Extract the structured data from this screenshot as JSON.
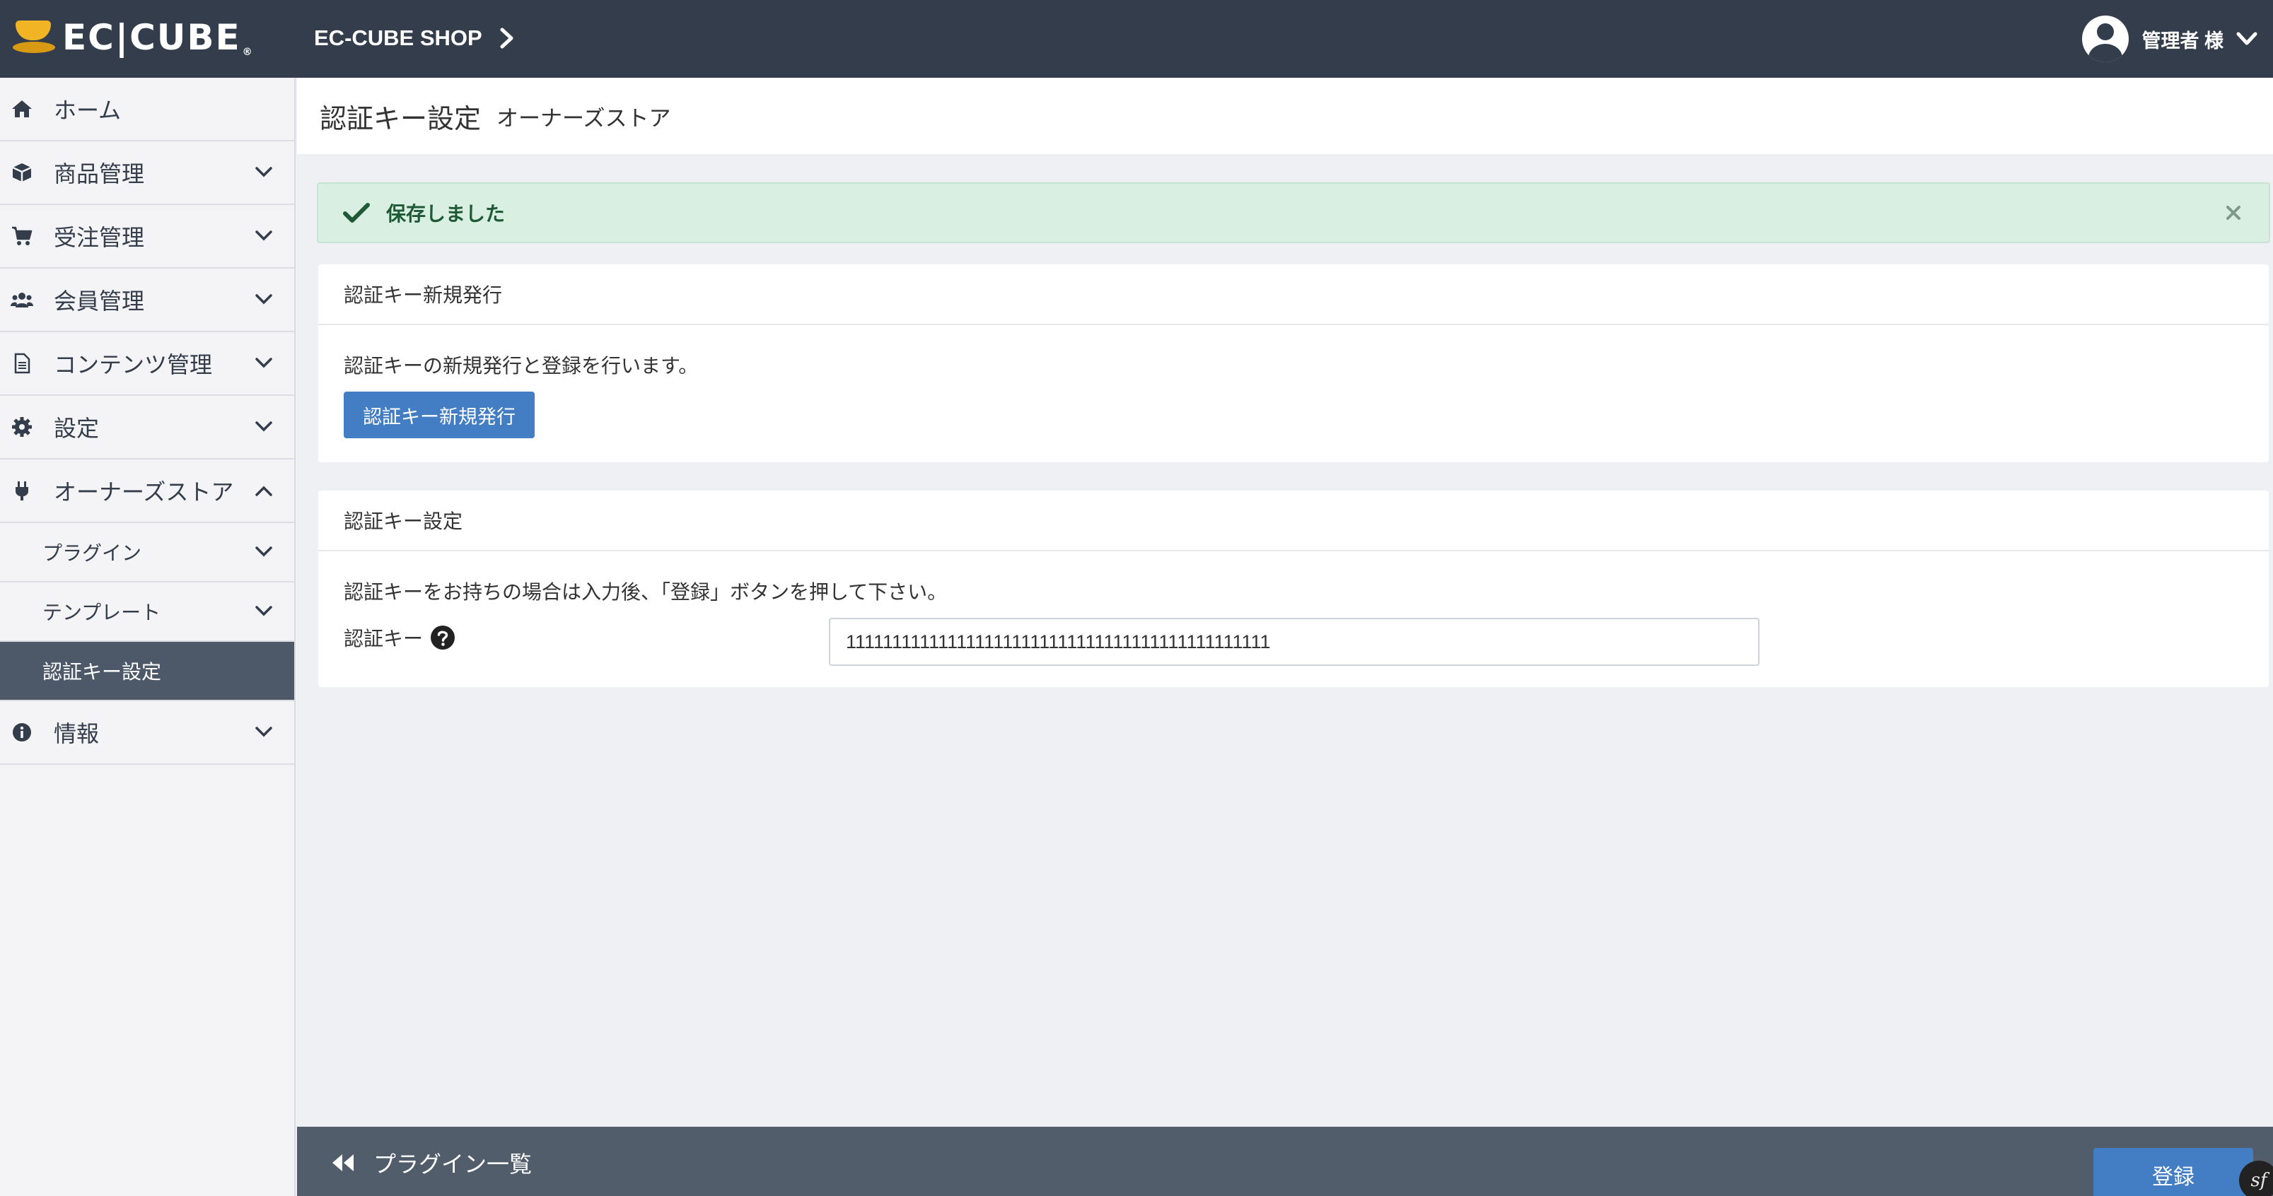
{
  "header": {
    "logo_text": "EC|CUBE",
    "logo_reg": "®",
    "shop_name": "EC-CUBE SHOP",
    "user_name": "管理者 様"
  },
  "sidebar": {
    "items": [
      {
        "label": "ホーム",
        "icon": "home-icon"
      },
      {
        "label": "商品管理",
        "icon": "box-icon"
      },
      {
        "label": "受注管理",
        "icon": "cart-icon"
      },
      {
        "label": "会員管理",
        "icon": "users-icon"
      },
      {
        "label": "コンテンツ管理",
        "icon": "file-icon"
      },
      {
        "label": "設定",
        "icon": "gear-icon"
      },
      {
        "label": "オーナーズストア",
        "icon": "plug-icon"
      }
    ],
    "sub_items": [
      {
        "label": "プラグイン"
      },
      {
        "label": "テンプレート"
      },
      {
        "label": "認証キー設定"
      }
    ],
    "info_item": {
      "label": "情報",
      "icon": "info-icon"
    }
  },
  "page": {
    "title": "認証キー設定",
    "subtitle": "オーナーズストア"
  },
  "alert": {
    "message": "保存しました"
  },
  "card_new_key": {
    "header": "認証キー新規発行",
    "description": "認証キーの新規発行と登録を行います。",
    "button_label": "認証キー新規発行"
  },
  "card_key_settings": {
    "header": "認証キー設定",
    "description": "認証キーをお持ちの場合は入力後、「登録」ボタンを押して下さい。",
    "field_label": "認証キー",
    "field_value": "1111111111111111111111111111111111111111111111"
  },
  "footer": {
    "back_label": "プラグイン一覧",
    "register_label": "登録",
    "sf_badge": "sf"
  },
  "colors": {
    "header_bg": "#333d4b",
    "accent": "#437ec4",
    "success_bg": "#d9efe2",
    "sidebar_active": "#4d5969"
  }
}
